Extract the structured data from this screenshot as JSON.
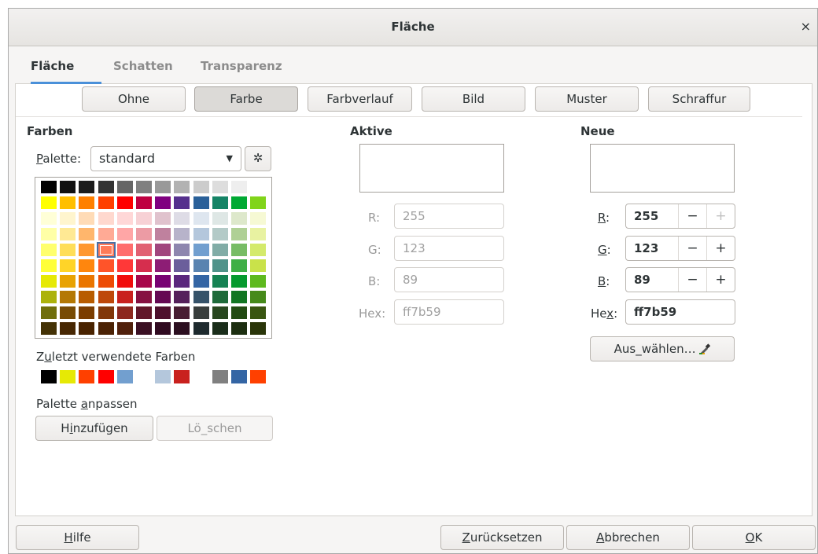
{
  "window": {
    "title": "Fläche",
    "close_symbol": "×"
  },
  "tabs": [
    {
      "label": "Fläche",
      "active": true
    },
    {
      "label": "Schatten",
      "active": false
    },
    {
      "label": "Transparenz",
      "active": false
    }
  ],
  "fill_types": {
    "none": "Ohne",
    "color": "Farbe",
    "gradient": "Farbverlauf",
    "image": "Bild",
    "pattern": "Muster",
    "hatching": "Schraffur",
    "selected": "Farbe"
  },
  "colors_section": {
    "heading": "Farben",
    "palette_label_pre": "",
    "palette_label_mnemonic": "P",
    "palette_label_post": "alette:",
    "palette_value": "standard",
    "settings_icon": "gear-icon",
    "selected_swatch": "ff7b59",
    "palette_grid": [
      [
        "#000000",
        "#111111",
        "#1c1c1c",
        "#333333",
        "#666666",
        "#808080",
        "#999999",
        "#b2b2b2",
        "#cccccc",
        "#dddddd",
        "#eeeeee",
        "#ffffff"
      ],
      [
        "#ffff00",
        "#ffbf00",
        "#ff8000",
        "#ff4000",
        "#ff0000",
        "#bf0041",
        "#800080",
        "#55308d",
        "#2a6099",
        "#158466",
        "#00a933",
        "#81d41a"
      ],
      [
        "#ffffd7",
        "#fff5ce",
        "#ffdbb6",
        "#ffd8ce",
        "#ffd7d7",
        "#f7d1d5",
        "#e0c2cd",
        "#dedce6",
        "#dee6ef",
        "#dee7e5",
        "#dde8cb",
        "#f6f9d4"
      ],
      [
        "#ffffa6",
        "#ffe994",
        "#ffb66c",
        "#ffaa95",
        "#ffa6a6",
        "#ec9ba4",
        "#bf819e",
        "#b7b3ca",
        "#b4c7dc",
        "#b3cac7",
        "#afd095",
        "#e8f2a1"
      ],
      [
        "#ffff6d",
        "#ffde59",
        "#ff972f",
        "#ff7b59",
        "#ff6d6d",
        "#e16173",
        "#a1467e",
        "#8e86ae",
        "#729fcf",
        "#81aca6",
        "#77bc65",
        "#d4ea6b"
      ],
      [
        "#ffff38",
        "#ffd428",
        "#ff860d",
        "#ff5429",
        "#ff3838",
        "#d62e4e",
        "#8d1d75",
        "#6b5e9b",
        "#5983b0",
        "#50938a",
        "#3faf46",
        "#c9e24a"
      ],
      [
        "#e6e905",
        "#e8a202",
        "#ea7500",
        "#ed4c05",
        "#f10d0c",
        "#a7074b",
        "#780373",
        "#5b277d",
        "#3465a4",
        "#168253",
        "#069a2e",
        "#5eb91e"
      ],
      [
        "#acb20c",
        "#b47804",
        "#b85c00",
        "#be480a",
        "#c9211e",
        "#861141",
        "#650953",
        "#55215b",
        "#355269",
        "#1e6a39",
        "#127622",
        "#468a1a"
      ],
      [
        "#706e0c",
        "#784b04",
        "#7b3d00",
        "#813709",
        "#8d281e",
        "#611729",
        "#4e102d",
        "#481d32",
        "#383d3c",
        "#28471f",
        "#224b12",
        "#395511"
      ],
      [
        "#443205",
        "#472702",
        "#492300",
        "#4b2204",
        "#50200b",
        "#3b1023",
        "#300a20",
        "#2c0f20",
        "#1e2a2e",
        "#1a2d1a",
        "#1c2e10",
        "#2a3509"
      ]
    ]
  },
  "recent": {
    "label_pre": "Z",
    "label_mnemonic": "u",
    "label_post": "letzt verwendete Farben",
    "colors": [
      "#000000",
      "#e6e905",
      "#ff4000",
      "#ff0000",
      "#729fcf",
      "#ffffff",
      "#b4c7dc",
      "#c9211e",
      "#ffffff",
      "#808080",
      "#3465a4",
      "#ff4000"
    ]
  },
  "customize": {
    "label_pre": "Palette ",
    "label_mnemonic": "a",
    "label_post": "npassen",
    "add_pre": "H",
    "add_mnemonic": "i",
    "add_post": "nzufügen",
    "delete": "Lö_schen"
  },
  "active": {
    "heading": "Aktive",
    "preview_color": "#ffffff",
    "r_label": "R:",
    "r_value": "255",
    "g_label": "G:",
    "g_value": "123",
    "b_label": "B:",
    "b_value": "89",
    "hex_label": "Hex:",
    "hex_value": "ff7b59"
  },
  "new": {
    "heading": "Neue",
    "preview_color": "#ffffff",
    "r_label_mnemonic": "R",
    "r_label_post": ":",
    "r_value": "255",
    "g_label_mnemonic": "G",
    "g_label_post": ":",
    "g_value": "123",
    "b_label_mnemonic": "B",
    "b_label_post": ":",
    "b_value": "89",
    "hex_label_pre": "He",
    "hex_label_mnemonic": "x",
    "hex_label_post": ":",
    "hex_value": "ff7b59",
    "minus": "−",
    "plus": "+",
    "pick_button": "Aus_wählen…",
    "pick_icon": "eyedropper-icon"
  },
  "footer": {
    "help_mnemonic": "H",
    "help_post": "ilfe",
    "reset_mnemonic": "Z",
    "reset_post": "urücksetzen",
    "cancel_mnemonic": "A",
    "cancel_post": "bbrechen",
    "ok_mnemonic": "O",
    "ok_post": "K"
  }
}
